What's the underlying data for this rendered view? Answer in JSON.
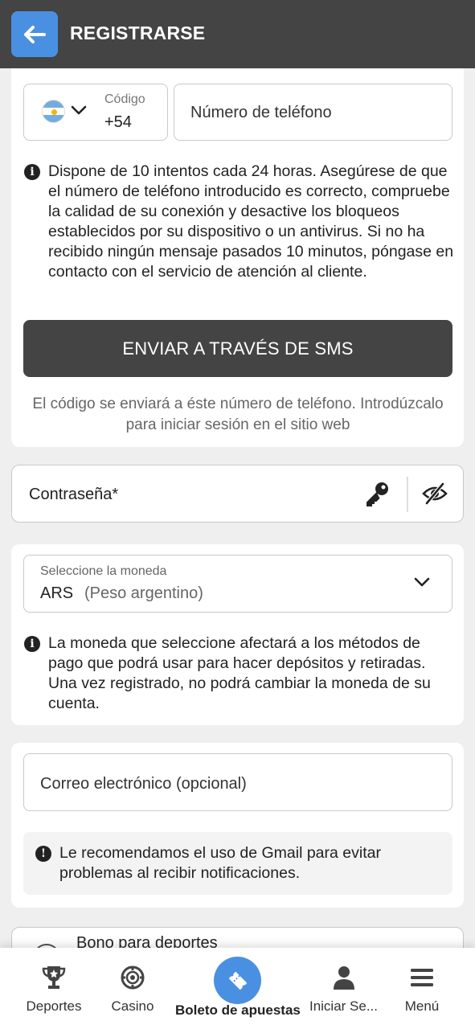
{
  "header": {
    "title": "REGISTRARSE",
    "back_icon": "arrow-left-icon"
  },
  "phone_section": {
    "country_flag": "argentina-flag-icon",
    "code_label": "Código",
    "code_value": "+54",
    "phone_placeholder": "Número de teléfono",
    "info_text": "Dispone de 10 intentos cada 24 horas. Asegúrese de que el número de teléfono introducido es correcto, compruebe la calidad de su conexión y desactive los bloqueos establecidos por su dispositivo o un antivirus. Si no ha recibido ningún mensaje pasados 10 minutos, póngase en contacto con el servicio de atención al cliente.",
    "sms_button": "ENVIAR A TRAVÉS DE SMS",
    "sms_note": "El código se enviará a éste número de teléfono. Introdúzcalo para iniciar sesión en el sitio web"
  },
  "password": {
    "label": "Contraseña*"
  },
  "currency": {
    "label": "Seleccione la moneda",
    "code": "ARS",
    "name": "(Peso argentino)",
    "info_text": "La moneda que seleccione afectará a los métodos de pago que podrá usar para hacer depósitos y retiradas. Una vez registrado, no podrá cambiar la moneda de su cuenta."
  },
  "email": {
    "placeholder": "Correo electrónico (opcional)",
    "gmail_notice": "Le recomendamos el uso de Gmail para evitar problemas al recibir notificaciones."
  },
  "bonus": {
    "label": "Bono para deportes"
  },
  "bottom_nav": {
    "items": [
      {
        "label": "Deportes",
        "icon": "trophy-icon"
      },
      {
        "label": "Casino",
        "icon": "casino-chip-icon"
      },
      {
        "label": "Boleto de apuestas",
        "icon": "ticket-icon"
      },
      {
        "label": "Iniciar Se...",
        "icon": "user-icon"
      },
      {
        "label": "Menú",
        "icon": "menu-icon"
      }
    ]
  },
  "colors": {
    "header_bg": "#444444",
    "accent": "#4a90e2",
    "button_bg": "#444444"
  }
}
